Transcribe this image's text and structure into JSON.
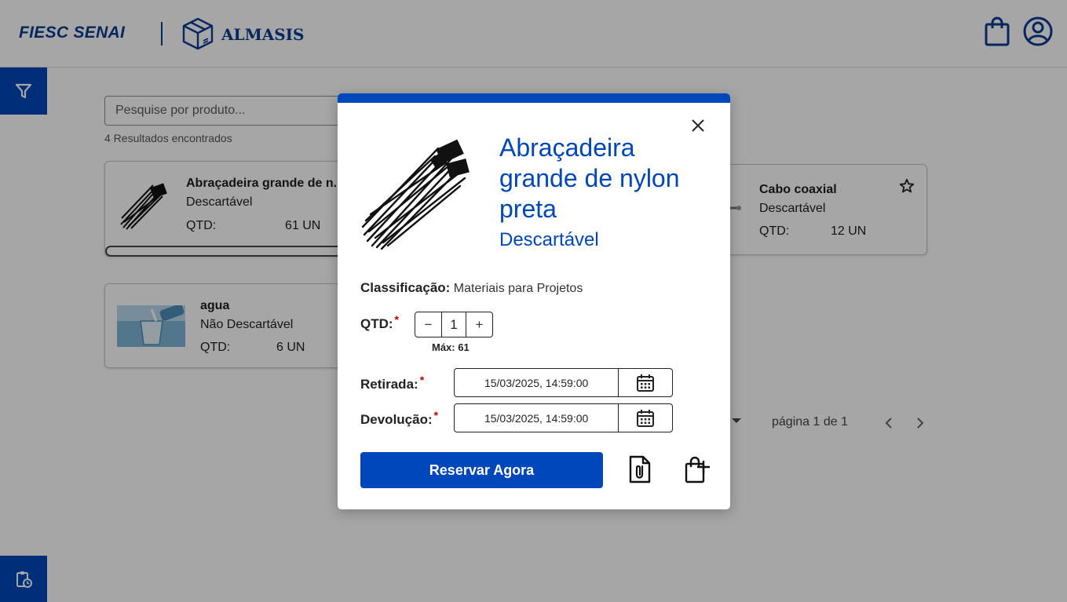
{
  "header": {
    "logo_fiesc": "FIESC SENAI",
    "logo_app": "ALMASIS"
  },
  "search": {
    "placeholder": "Pesquise por produto...",
    "results_count": "4 Resultados encontrados"
  },
  "cards": [
    {
      "name": "Abraçadeira grande de n...",
      "type": "Descartável",
      "qtd_label": "QTD:",
      "qtd_value": "61 UN"
    },
    {
      "name": "Cabo coaxial",
      "type": "Descartável",
      "qtd_label": "QTD:",
      "qtd_value": "12 UN"
    },
    {
      "name": "agua",
      "type": "Não Descartável",
      "qtd_label": "QTD:",
      "qtd_value": "6 UN"
    }
  ],
  "pagination": {
    "text": "página 1 de 1"
  },
  "modal": {
    "title": "Abraçadeira grande de nylon preta",
    "subtitle": "Descartável",
    "classification_label": "Classificação:",
    "classification_value": "Materiais para Projetos",
    "qtd_label": "QTD:",
    "required_mark": "*",
    "qtd_minus": "−",
    "qtd_value": "1",
    "qtd_plus": "+",
    "max_text": "Máx: 61",
    "pickup_label": "Retirada:",
    "pickup_value": "15/03/2025, 14:59:00",
    "return_label": "Devolução:",
    "return_value": "15/03/2025, 14:59:00",
    "reserve_button": "Reservar Agora"
  },
  "colors": {
    "brand_blue": "#0047bb",
    "logo_blue": "#0a3d91",
    "required_red": "#c00000"
  },
  "icons": [
    "box-logo-icon",
    "shopping-bag-icon",
    "user-circle-icon",
    "filter-icon",
    "clipboard-clock-icon",
    "star-icon",
    "chevron-left-icon",
    "chevron-right-icon",
    "close-icon",
    "calendar-icon",
    "file-attachment-icon",
    "bag-plus-icon"
  ]
}
